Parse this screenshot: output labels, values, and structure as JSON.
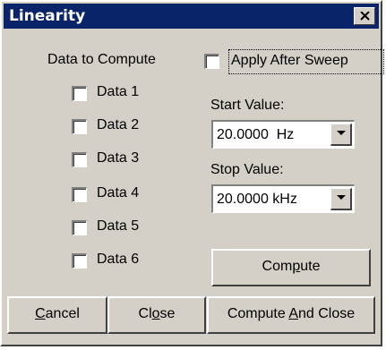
{
  "window": {
    "title": "Linearity",
    "title_bar_color": "#0a246a",
    "face_color": "#d4d0c8"
  },
  "data_section": {
    "heading": "Data to Compute",
    "items": [
      {
        "label": "Data 1",
        "checked": false
      },
      {
        "label": "Data 2",
        "checked": false
      },
      {
        "label": "Data 3",
        "checked": false
      },
      {
        "label": "Data 4",
        "checked": false
      },
      {
        "label": "Data 5",
        "checked": false
      },
      {
        "label": "Data 6",
        "checked": false
      }
    ]
  },
  "apply_after_sweep": {
    "label": "Apply After Sweep",
    "checked": false
  },
  "start": {
    "label": "Start Value:",
    "value": "20.0000  Hz"
  },
  "stop": {
    "label": "Stop Value:",
    "value": "20.0000 kHz"
  },
  "buttons": {
    "compute": {
      "pre": "Com",
      "accel": "p",
      "post": "ute"
    },
    "cancel": {
      "pre": "",
      "accel": "C",
      "post": "ancel"
    },
    "close": {
      "pre": "Cl",
      "accel": "o",
      "post": "se"
    },
    "compute_and_close": {
      "pre": "Compute ",
      "accel": "A",
      "post": "nd Close"
    }
  },
  "icons": {
    "close": "close-x-icon",
    "dropdown": "dropdown-arrow-icon"
  }
}
